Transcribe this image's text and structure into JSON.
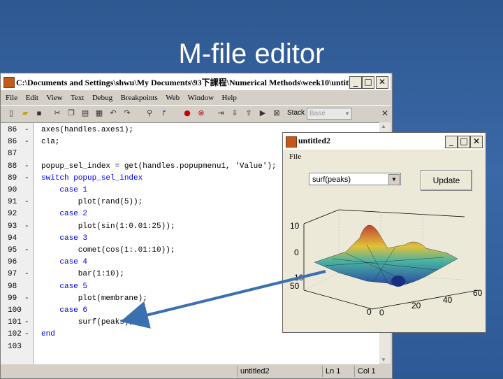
{
  "slide": {
    "title": "M-file editor"
  },
  "editor": {
    "title": "C:\\Documents and Settings\\shwu\\My Documents\\93下課程\\Numerical Methods\\week10\\untitled…",
    "window_buttons": [
      "_",
      "□",
      "✕"
    ],
    "menu": [
      "File",
      "Edit",
      "View",
      "Text",
      "Debug",
      "Breakpoints",
      "Web",
      "Window",
      "Help"
    ],
    "toolbar_icons": [
      "new-file-icon",
      "open-icon",
      "save-icon",
      "cut-icon",
      "copy-icon",
      "paste-icon",
      "print-icon",
      "undo-icon",
      "redo-icon",
      "find-icon",
      "function-icon",
      "breakpoint-set-icon",
      "breakpoint-clear-icon",
      "step-icon",
      "step-in-icon",
      "step-out-icon",
      "continue-icon",
      "exit-debug-icon"
    ],
    "stack_label": "Stack",
    "stack_value": "Base",
    "close_x": "✕",
    "lines": [
      {
        "no": "86",
        "dash": "-",
        "code": "axes(handles.axes1);"
      },
      {
        "no": "86",
        "dash": "-",
        "code": "cla;"
      },
      {
        "no": "87",
        "dash": "",
        "code": ""
      },
      {
        "no": "88",
        "dash": "-",
        "code": "popup_sel_index = get(handles.popupmenu1, 'Value');"
      },
      {
        "no": "89",
        "dash": "-",
        "code": "switch popup_sel_index"
      },
      {
        "no": "90",
        "dash": "",
        "code": "    case 1"
      },
      {
        "no": "91",
        "dash": "-",
        "code": "        plot(rand(5));"
      },
      {
        "no": "92",
        "dash": "",
        "code": "    case 2"
      },
      {
        "no": "93",
        "dash": "-",
        "code": "        plot(sin(1:0.01:25));"
      },
      {
        "no": "94",
        "dash": "",
        "code": "    case 3"
      },
      {
        "no": "95",
        "dash": "-",
        "code": "        comet(cos(1:.01:10));"
      },
      {
        "no": "96",
        "dash": "",
        "code": "    case 4"
      },
      {
        "no": "97",
        "dash": "-",
        "code": "        bar(1:10);"
      },
      {
        "no": "98",
        "dash": "",
        "code": "    case 5"
      },
      {
        "no": "99",
        "dash": "-",
        "code": "        plot(membrane);"
      },
      {
        "no": "100",
        "dash": "",
        "code": "    case 6"
      },
      {
        "no": "101",
        "dash": "-",
        "code": "        surf(peaks);"
      },
      {
        "no": "102",
        "dash": "-",
        "code": "end"
      },
      {
        "no": "103",
        "dash": "",
        "code": ""
      }
    ],
    "status_file": "untitled2",
    "status_ln": "Ln 1",
    "status_col": "Col 1"
  },
  "gui": {
    "title": "untitled2",
    "menu_file": "File",
    "popup_value": "surf(peaks)",
    "update_label": "Update",
    "z_ticks": [
      "10",
      "0",
      "-10"
    ],
    "y_ticks": [
      "50",
      "0"
    ],
    "x_ticks": [
      "0",
      "20",
      "40",
      "60"
    ]
  }
}
